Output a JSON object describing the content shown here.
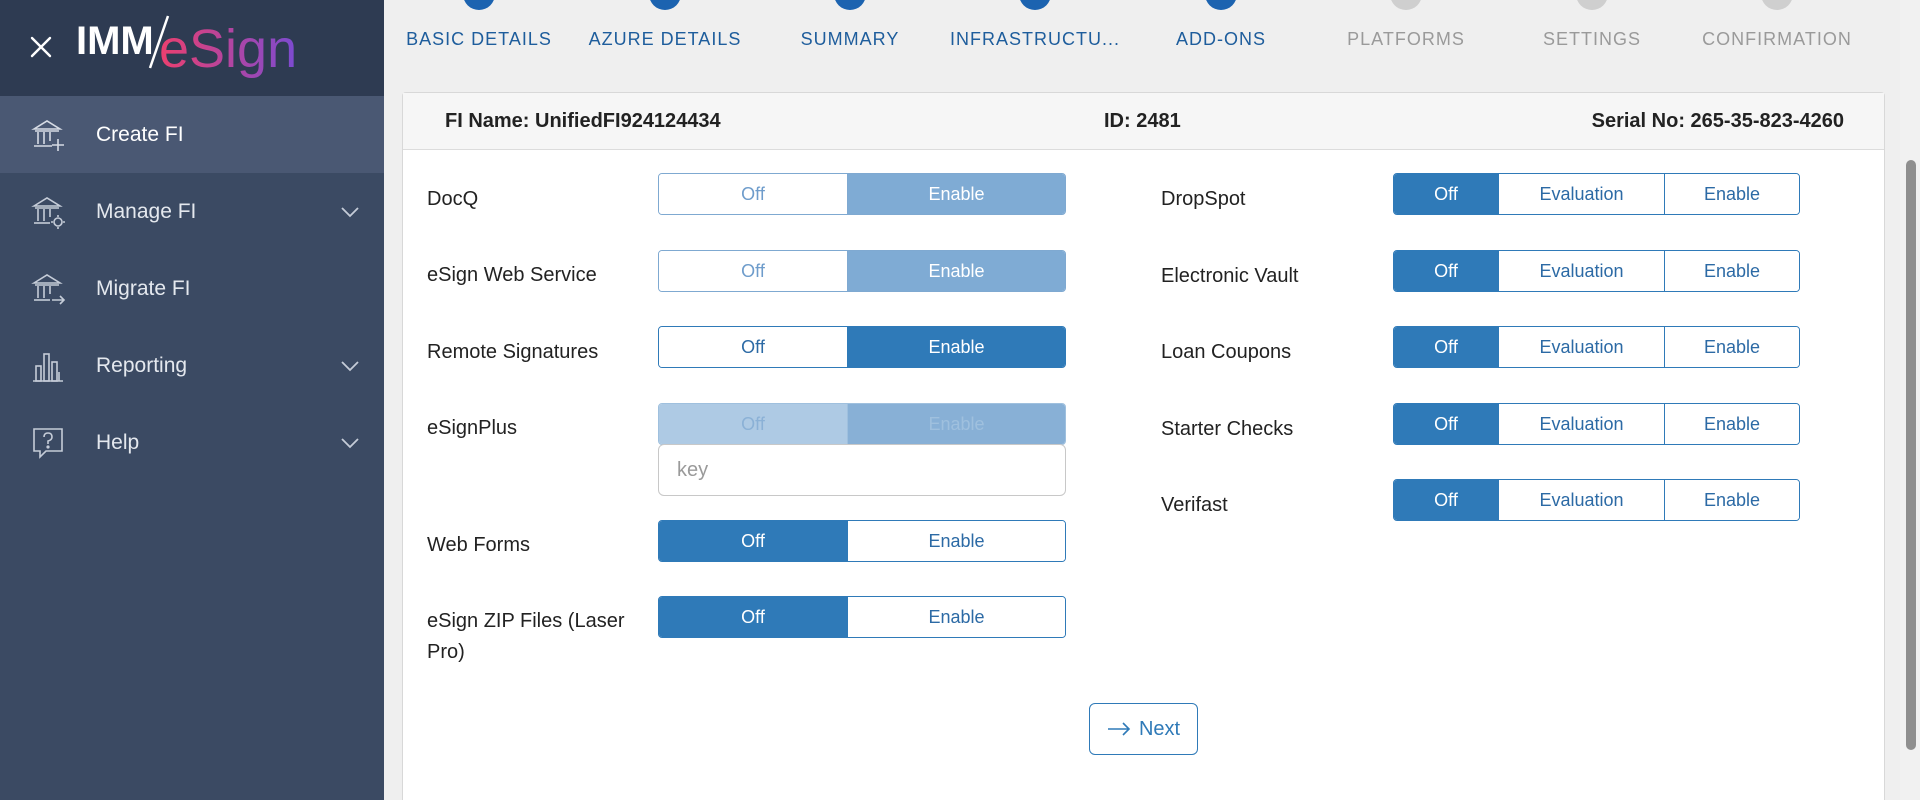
{
  "sidebar": {
    "logo_text_left": "IMM",
    "logo_text_right": "eSign",
    "items": [
      {
        "label": "Create FI",
        "icon": "bank-plus-icon",
        "active": true
      },
      {
        "label": "Manage FI",
        "icon": "bank-gear-icon",
        "expandable": true
      },
      {
        "label": "Migrate FI",
        "icon": "bank-arrow-icon"
      },
      {
        "label": "Reporting",
        "icon": "bar-chart-icon",
        "expandable": true
      },
      {
        "label": "Help",
        "icon": "help-bubble-icon",
        "expandable": true
      }
    ]
  },
  "stepper": {
    "steps": [
      {
        "label": "BASIC DETAILS",
        "status": "done"
      },
      {
        "label": "AZURE DETAILS",
        "status": "done"
      },
      {
        "label": "SUMMARY",
        "status": "done"
      },
      {
        "label": "INFRASTRUCTU...",
        "status": "done"
      },
      {
        "label": "ADD-ONS",
        "status": "done"
      },
      {
        "label": "PLATFORMS",
        "status": "todo"
      },
      {
        "label": "SETTINGS",
        "status": "todo"
      },
      {
        "label": "CONFIRMATION",
        "status": "todo"
      }
    ]
  },
  "header": {
    "fi_name": "FI Name: UnifiedFI924124434",
    "id": "ID: 2481",
    "serial": "Serial No: 265-35-823-4260"
  },
  "left_options": [
    {
      "label": "DocQ",
      "options": [
        "Off",
        "Enable"
      ],
      "selected": 1,
      "state": "faded"
    },
    {
      "label": "eSign Web Service",
      "options": [
        "Off",
        "Enable"
      ],
      "selected": 1,
      "state": "faded"
    },
    {
      "label": "Remote Signatures",
      "options": [
        "Off",
        "Enable"
      ],
      "selected": 1,
      "state": "normal"
    },
    {
      "label": "eSignPlus",
      "options": [
        "Off",
        "Enable"
      ],
      "selected": 1,
      "state": "disabled"
    },
    {
      "label": "Web Forms",
      "options": [
        "Off",
        "Enable"
      ],
      "selected": 0,
      "state": "normal"
    },
    {
      "label": "eSign ZIP Files (Laser Pro)",
      "options": [
        "Off",
        "Enable"
      ],
      "selected": 0,
      "state": "normal"
    }
  ],
  "right_options": [
    {
      "label": "DropSpot",
      "options": [
        "Off",
        "Evaluation",
        "Enable"
      ],
      "selected": 0
    },
    {
      "label": "Electronic Vault",
      "options": [
        "Off",
        "Evaluation",
        "Enable"
      ],
      "selected": 0
    },
    {
      "label": "Loan Coupons",
      "options": [
        "Off",
        "Evaluation",
        "Enable"
      ],
      "selected": 0
    },
    {
      "label": "Starter Checks",
      "options": [
        "Off",
        "Evaluation",
        "Enable"
      ],
      "selected": 0
    },
    {
      "label": "Verifast",
      "options": [
        "Off",
        "Evaluation",
        "Enable"
      ],
      "selected": 0
    }
  ],
  "key_input": {
    "placeholder": "key",
    "value": ""
  },
  "next_button": {
    "label": "Next"
  },
  "colors": {
    "sidebar": "#3b4a63",
    "accent": "#2f7ab8",
    "step_done": "#1c63b0"
  }
}
